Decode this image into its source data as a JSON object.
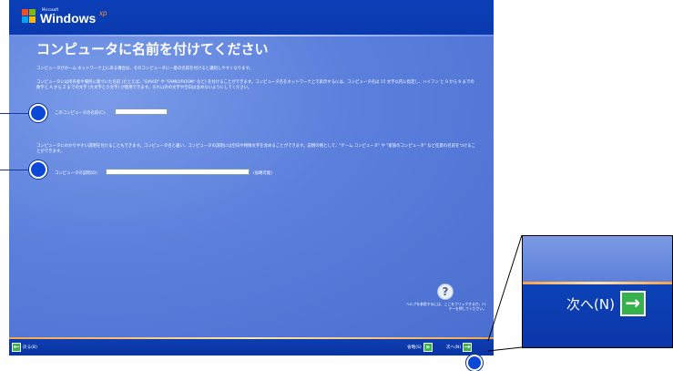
{
  "header": {
    "microsoft_label": "Microsoft",
    "windows_label": "Windows",
    "xp_label": "xp"
  },
  "page": {
    "title": "コンピュータに名前を付けてください",
    "intro": "コンピュータがホーム ネットワーク上にある場合は、そのコンピュータに一意の名前を付けると識別しやすくなります。",
    "rules": "コンピュータには所有者や場所に基づいた名前 (たとえば、\"DAVID\" や \"FAMILYROOM\" など) を付けることができます。コンピュータ名をネットワーク上で表示するには、コンピュータ名は 15 文字以内に指定し、ハイフン と 0 から 9 までの数字と A から Z までの文字 (大文字と小文字) が使用できます。それ以外の文字や空白は含めないようにしてください。",
    "name_label": "このコンピュータの名前(C):",
    "name_value": "",
    "desc_text": "コンピュータにわかりやすい説明を付けることもできます。コンピュータ名と違い、コンピュータの説明には空白や特殊文字を含めることができます。説明の例として、\"ゲーム コンピュータ\" や \"家族のコンピュータ\" など任意の名前をつけることができます。",
    "desc_label": "コンピュータの説明(D):",
    "desc_value": "",
    "optional_label": "(省略可能)"
  },
  "help": {
    "icon_glyph": "?",
    "text": "ヘルプを参照するには、ここをクリックするか、F1 キーを押してください。"
  },
  "footer": {
    "back_label": "戻る(B)",
    "skip_label": "省略(S)",
    "next_label": "次へ(N)"
  },
  "zoom": {
    "next_label": "次へ(N)"
  },
  "colors": {
    "background": "#5a7edc",
    "top_bar": "#0b3fb8",
    "accent_line": "#f6a64a",
    "arrow_green": "#39b54a",
    "callout_circle": "#0a48d6"
  },
  "icons": [
    "windows-flag-icon",
    "help-icon",
    "back-arrow-icon",
    "skip-arrow-icon",
    "next-arrow-icon"
  ]
}
